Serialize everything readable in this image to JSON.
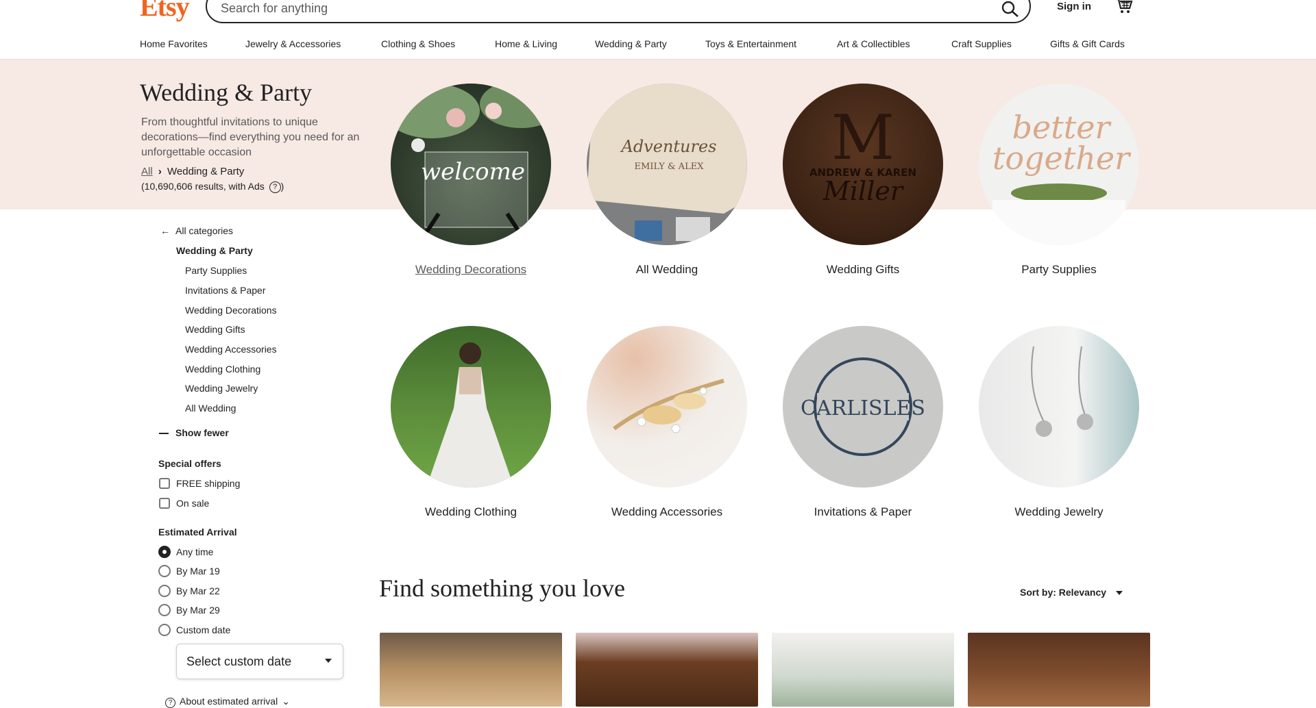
{
  "header": {
    "logo": "Etsy",
    "search_placeholder": "Search for anything",
    "sign_in": "Sign in",
    "icons": [
      "search-icon",
      "cart-icon"
    ]
  },
  "catnav": [
    "Home Favorites",
    "Jewelry & Accessories",
    "Clothing & Shoes",
    "Home & Living",
    "Wedding & Party",
    "Toys & Entertainment",
    "Art & Collectibles",
    "Craft Supplies",
    "Gifts & Gift Cards"
  ],
  "hero": {
    "title": "Wedding & Party",
    "description": "From thoughtful invitations to unique decorations—find everything you need for an unforgettable occasion",
    "crumb_all": "All",
    "crumb_current": "Wedding & Party",
    "results": "(10,690,606 results, with Ads",
    "results_close": ")"
  },
  "categories": [
    {
      "label": "Wedding Decorations"
    },
    {
      "label": "All Wedding"
    },
    {
      "label": "Wedding Gifts"
    },
    {
      "label": "Party Supplies"
    },
    {
      "label": "Wedding Clothing"
    },
    {
      "label": "Wedding Accessories"
    },
    {
      "label": "Invitations & Paper"
    },
    {
      "label": "Wedding Jewelry"
    }
  ],
  "sidebar": {
    "all_categories": "All categories",
    "current": "Wedding & Party",
    "subcats": [
      "Party Supplies",
      "Invitations & Paper",
      "Wedding Decorations",
      "Wedding Gifts",
      "Wedding Accessories",
      "Wedding Clothing",
      "Wedding Jewelry",
      "All Wedding"
    ],
    "show_fewer": "Show fewer",
    "special_offers": "Special offers",
    "offers": [
      "FREE shipping",
      "On sale"
    ],
    "estimated_arrival": "Estimated Arrival",
    "arrival_options": [
      "Any time",
      "By Mar 19",
      "By Mar 22",
      "By Mar 29",
      "Custom date"
    ],
    "select_custom": "Select custom date",
    "about_arrival": "About estimated arrival"
  },
  "main": {
    "heading": "Find something you love",
    "sort": "Sort by: Relevancy"
  },
  "colors": {
    "brand": "#f1641e",
    "hero_bg": "#f7e9e4"
  }
}
